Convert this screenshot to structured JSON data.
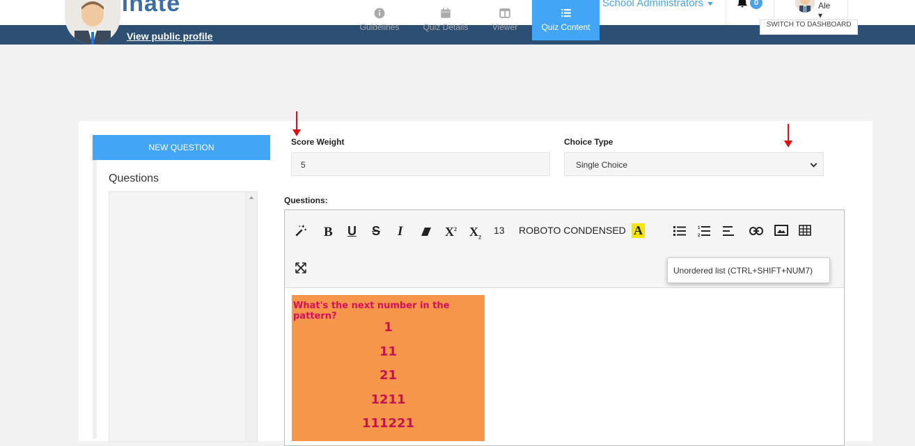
{
  "header": {
    "logo": "Luminate",
    "role_dropdown": "School Administrators",
    "notif_count": "0",
    "user_name": "Ale",
    "view_profile": "View public profile",
    "dashboard_button": "SWITCH TO DASHBOARD"
  },
  "tabs": [
    {
      "label": "Guidelines",
      "icon": "info-icon"
    },
    {
      "label": "Quiz Details",
      "icon": "calendar-icon"
    },
    {
      "label": "Viewer",
      "icon": "columns-icon"
    },
    {
      "label": "Quiz Content",
      "icon": "list-icon",
      "active": true
    }
  ],
  "sidebar": {
    "new_question": "NEW QUESTION",
    "questions_title": "Questions"
  },
  "form": {
    "score_weight_label": "Score Weight",
    "score_weight_value": "5",
    "choice_type_label": "Choice Type",
    "choice_type_value": "Single Choice",
    "questions_label": "Questions:"
  },
  "toolbar": {
    "font_size": "13",
    "font_name": "ROBOTO CONDENSED",
    "tooltip": "Unordered list (CTRL+SHIFT+NUM7)"
  },
  "content_image": {
    "title": "What's the next number in the pattern?",
    "numbers": [
      "1",
      "11",
      "21",
      "1211",
      "111221"
    ]
  },
  "colors": {
    "accent": "#42a5f5",
    "banner": "#2c4f73",
    "annotation_arrow": "#e01010",
    "pattern_bg": "#f5964a"
  }
}
